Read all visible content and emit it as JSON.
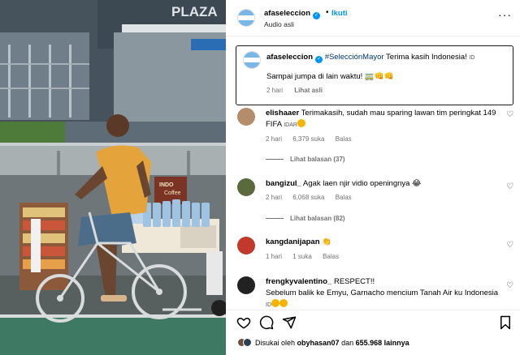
{
  "media": {
    "sign_text": "PLAZA",
    "box_text_1": "INDO",
    "box_text_2": "Coffee"
  },
  "header": {
    "username": "afaseleccion",
    "separator": "•",
    "follow_label": "Ikuti",
    "audio_label": "Audio asli",
    "more_label": "···"
  },
  "caption": {
    "username": "afaseleccion",
    "hashtag": "#SelecciónMayor",
    "text": " Terima kasih Indonesia! ",
    "flag_text": "ID",
    "line2": "Sampai jumpa di lain waktu! 🚃👊👊",
    "time": "2 hari",
    "see_original": "Lihat asli"
  },
  "comments": [
    {
      "username": "elishaaer",
      "text": " Terimakasih, sudah mau sparing lawan tim peringkat 149 FIFA ",
      "flag_text": "IDAR",
      "time": "2 hari",
      "likes": "6,379 suka",
      "reply": "Balas",
      "view_replies": "Lihat balasan (37)",
      "avatar_color": "#b58d6a"
    },
    {
      "username": "bangizul_",
      "text": " Agak laen njir vidio openingnya 😂",
      "time": "2 hari",
      "likes": "6,068 suka",
      "reply": "Balas",
      "view_replies": "Lihat balasan (82)",
      "avatar_color": "#5a6a3c"
    },
    {
      "username": "kangdanijapan",
      "text": " 👏",
      "time": "1 hari",
      "likes": "1 suka",
      "reply": "Balas",
      "avatar_color": "#c0392b"
    },
    {
      "username": "frengkyvalentino_",
      "text": " RESPECT!!",
      "text2": "Sebelum balik ke Emyu, Garnacho mencium Tanah Air ku Indonesia ",
      "flag_text": "ID",
      "avatar_color": "#222222"
    }
  ],
  "footer": {
    "liked_by_prefix": "Disukai oleh ",
    "liked_by_user": "obyhasan07",
    "liked_by_suffix": " dan ",
    "liked_count": "655.968 lainnya"
  },
  "icons": {
    "like": "heart-icon",
    "comment": "comment-icon",
    "share": "send-icon",
    "save": "bookmark-icon"
  },
  "colors": {
    "verified": "#0095f6",
    "follow": "#0095f6",
    "hashtag": "#00376b",
    "muted": "#737373"
  }
}
